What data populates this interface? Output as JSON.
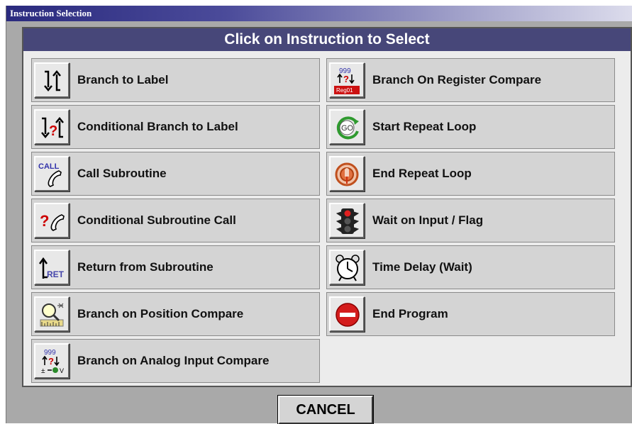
{
  "window": {
    "title": "Instruction Selection"
  },
  "header": "Click on Instruction to Select",
  "left_items": [
    {
      "label": "Branch to Label",
      "icon": "branch-arrows-icon"
    },
    {
      "label": "Conditional Branch to Label",
      "icon": "conditional-branch-icon"
    },
    {
      "label": "Call Subroutine",
      "icon": "call-phone-icon"
    },
    {
      "label": "Conditional Subroutine Call",
      "icon": "conditional-call-icon"
    },
    {
      "label": "Return from Subroutine",
      "icon": "return-ret-icon"
    },
    {
      "label": "Branch on Position Compare",
      "icon": "position-compare-icon"
    },
    {
      "label": "Branch on Analog Input Compare",
      "icon": "analog-compare-icon"
    }
  ],
  "right_items": [
    {
      "label": "Branch On Register Compare",
      "icon": "register-compare-icon"
    },
    {
      "label": "Start Repeat Loop",
      "icon": "go-loop-icon"
    },
    {
      "label": "End Repeat Loop",
      "icon": "end-loop-icon"
    },
    {
      "label": "Wait on Input / Flag",
      "icon": "traffic-light-icon"
    },
    {
      "label": "Time Delay (Wait)",
      "icon": "alarm-clock-icon"
    },
    {
      "label": "End Program",
      "icon": "stop-icon"
    }
  ],
  "icon_text": {
    "call": "CALL",
    "ret": "RET",
    "digits": "999",
    "reg": "Reg01",
    "go": "GO",
    "volt": "V",
    "plusminus": "±"
  },
  "cancel_label": "CANCEL",
  "colors": {
    "title_gradient_start": "#2a2a7e",
    "header_bg": "#474779",
    "item_bg": "#d4d4d4",
    "window_bg": "#a9a9a9"
  }
}
